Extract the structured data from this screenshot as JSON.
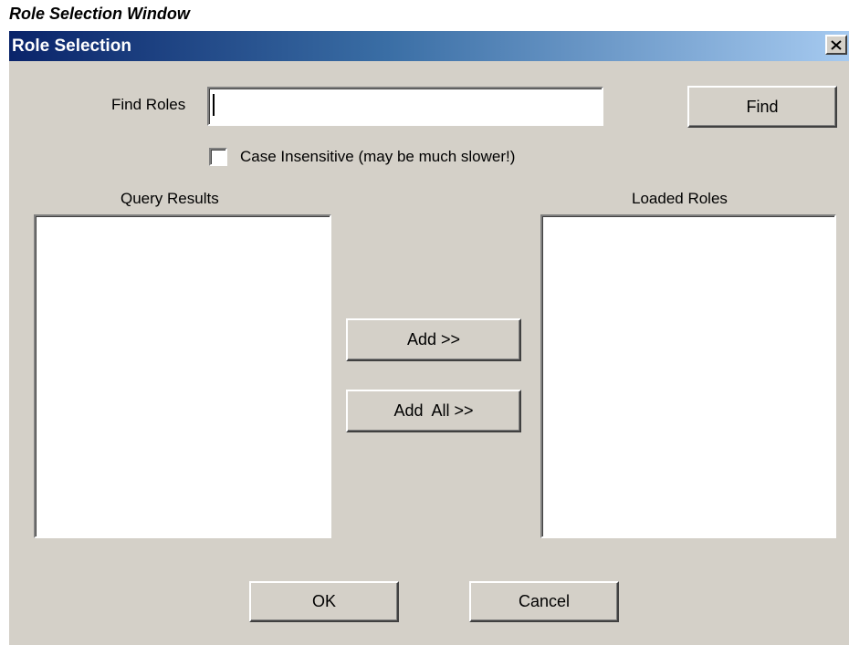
{
  "caption": "Role Selection Window",
  "window": {
    "title": "Role Selection",
    "close_icon": "close-icon",
    "close_glyph": "✕"
  },
  "find": {
    "label": "Find Roles",
    "value": "",
    "button_label": "Find"
  },
  "case_insensitive": {
    "label": "Case Insensitive (may be much slower!)",
    "checked": false
  },
  "query_results": {
    "label": "Query Results",
    "items": []
  },
  "loaded_roles": {
    "label": "Loaded Roles",
    "items": []
  },
  "actions": {
    "add_label": "Add >>",
    "add_all_label": "Add  All >>"
  },
  "footer": {
    "ok_label": "OK",
    "cancel_label": "Cancel"
  },
  "colors": {
    "face": "#d4d0c8",
    "titlebar_start": "#0a246a",
    "titlebar_end": "#a6caf0"
  }
}
